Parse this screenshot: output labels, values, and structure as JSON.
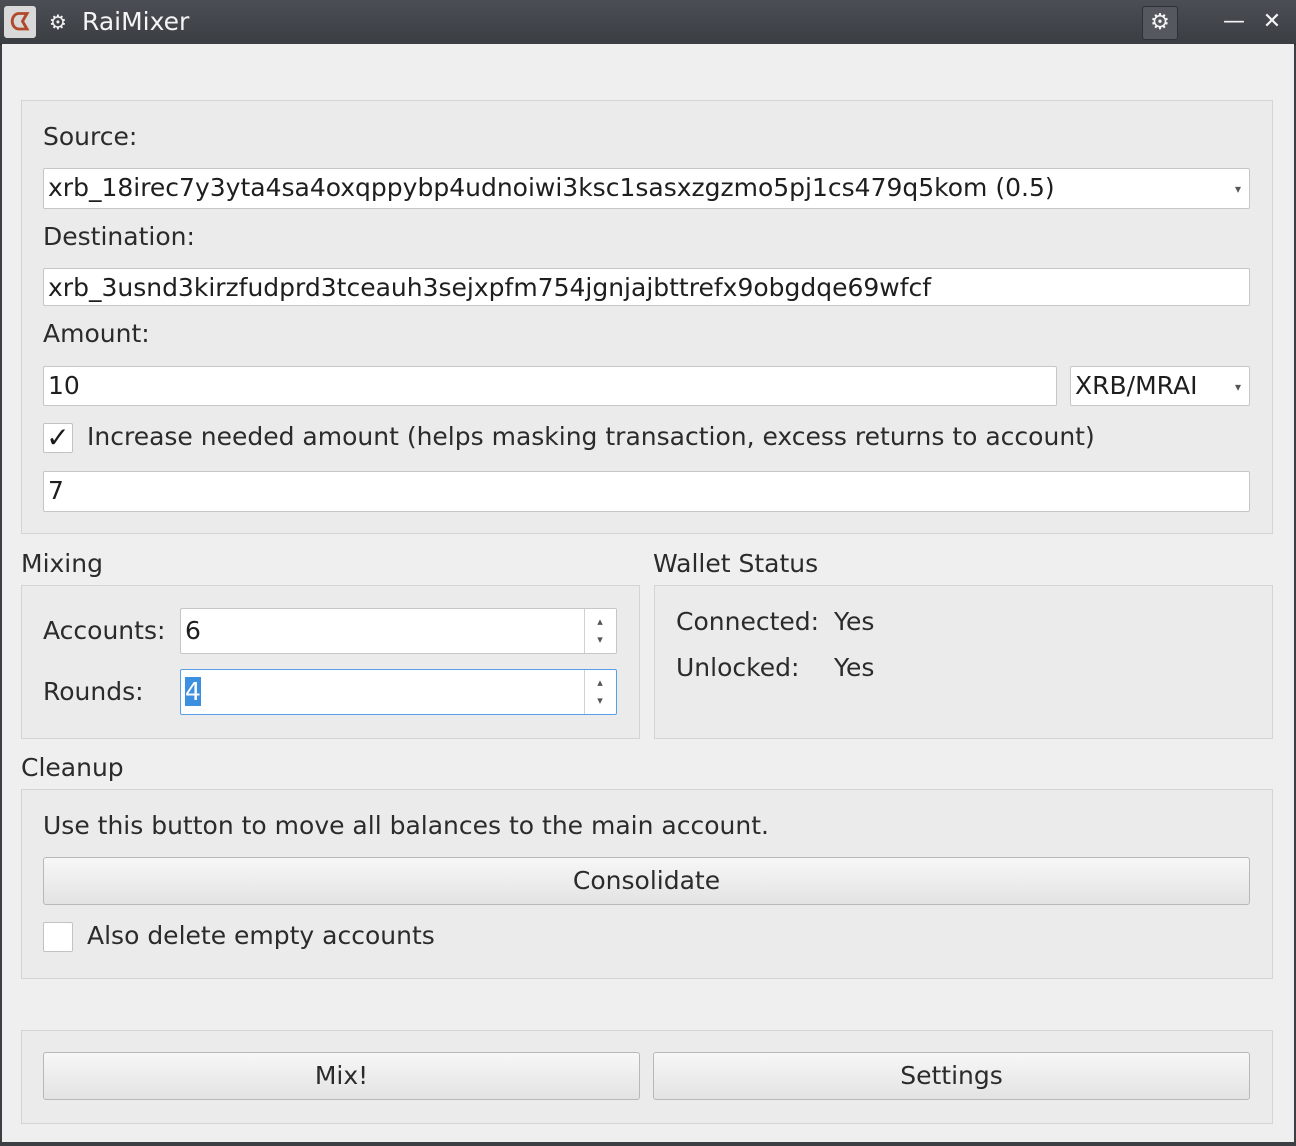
{
  "titlebar": {
    "app_icon_glyph": "ᗧ",
    "menu_icon_glyph": "⚙",
    "title": "RaiMixer",
    "buttons": {
      "pin_glyph": "⚙",
      "minimize_glyph": "—",
      "close_glyph": "✕"
    }
  },
  "source_group": {
    "source_label": "Source:",
    "source_value": "xrb_18irec7y3yta4sa4oxqppybp4udnoiwi3ksc1sasxzgzmo5pj1cs479q5kom (0.5)",
    "destination_label": "Destination:",
    "destination_value": "xrb_3usnd3kirzfudprd3tceauh3sejxpfm754jgnjajbttrefx9obgdqe69wfcf",
    "amount_label": "Amount:",
    "amount_value": "10",
    "unit_value": "XRB/MRAI",
    "increase_checked": true,
    "increase_label": "Increase needed amount (helps masking transaction, excess returns to account)",
    "increase_value": "7"
  },
  "mixing": {
    "title": "Mixing",
    "accounts_label": "Accounts:",
    "accounts_value": "6",
    "rounds_label": "Rounds:",
    "rounds_value": "4"
  },
  "wallet_status": {
    "title": "Wallet Status",
    "connected_label": "Connected:",
    "connected_value": "Yes",
    "unlocked_label": "Unlocked:",
    "unlocked_value": "Yes"
  },
  "cleanup": {
    "title": "Cleanup",
    "description": "Use this button to move all balances to the main account.",
    "consolidate_label": "Consolidate",
    "delete_empty_checked": false,
    "delete_empty_label": "Also delete empty accounts"
  },
  "actions": {
    "mix_label": "Mix!",
    "settings_label": "Settings"
  },
  "icons": {
    "combo_arrow": "▾",
    "spin_up": "▴",
    "spin_down": "▾",
    "check": "✓"
  }
}
